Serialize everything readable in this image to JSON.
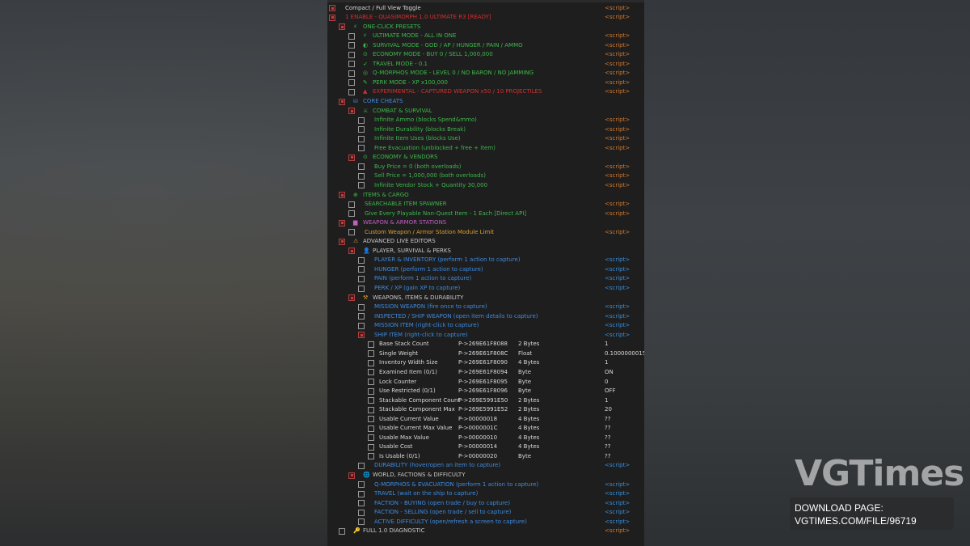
{
  "rows": [
    {
      "indent": 0,
      "checked": true,
      "icon": "",
      "iconColor": "",
      "label": "Compact / Full View Toggle",
      "color": "c-w",
      "script": "<script>",
      "scriptColor": "g"
    },
    {
      "indent": 0,
      "checked": true,
      "icon": "",
      "iconColor": "",
      "label": "1 ENABLE - QUASIMORPH 1.0 ULTIMATE R3 [READY]",
      "color": "c-r",
      "script": "<script>",
      "scriptColor": "g"
    },
    {
      "indent": 1,
      "checked": true,
      "icon": "⚡",
      "iconColor": "c-g",
      "label": "ONE-CLICK PRESETS",
      "color": "c-g",
      "script": "",
      "scriptColor": ""
    },
    {
      "indent": 2,
      "checked": false,
      "icon": "⚡",
      "iconColor": "c-g",
      "label": "ULTIMATE MODE - ALL IN ONE",
      "color": "c-g",
      "script": "<script>",
      "scriptColor": "g"
    },
    {
      "indent": 2,
      "checked": false,
      "icon": "◐",
      "iconColor": "c-g",
      "label": "SURVIVAL MODE - GOD / AP / HUNGER / PAIN / AMMO",
      "color": "c-g",
      "script": "<script>",
      "scriptColor": "g"
    },
    {
      "indent": 2,
      "checked": false,
      "icon": "⊙",
      "iconColor": "c-g",
      "label": "ECONOMY MODE - BUY 0 / SELL 1,000,000",
      "color": "c-g",
      "script": "<script>",
      "scriptColor": "g"
    },
    {
      "indent": 2,
      "checked": false,
      "icon": "➶",
      "iconColor": "c-g",
      "label": "TRAVEL MODE - 0.1",
      "color": "c-g",
      "script": "<script>",
      "scriptColor": "g"
    },
    {
      "indent": 2,
      "checked": false,
      "icon": "◎",
      "iconColor": "c-g",
      "label": "Q-MORPHOS MODE - LEVEL 0 / NO BARON / NO JAMMING",
      "color": "c-g",
      "script": "<script>",
      "scriptColor": "g"
    },
    {
      "indent": 2,
      "checked": false,
      "icon": "✎",
      "iconColor": "c-g",
      "label": "PERK MODE - XP x100,000",
      "color": "c-g",
      "script": "<script>",
      "scriptColor": "g"
    },
    {
      "indent": 2,
      "checked": false,
      "icon": "▲",
      "iconColor": "c-r",
      "label": "EXPERIMENTAL - CAPTURED WEAPON x50 / 10 PROJECTILES",
      "color": "c-r",
      "script": "<script>",
      "scriptColor": "g"
    },
    {
      "indent": 1,
      "checked": true,
      "icon": "⛁",
      "iconColor": "c-bl",
      "label": "CORE CHEATS",
      "color": "c-bl",
      "script": "",
      "scriptColor": ""
    },
    {
      "indent": 2,
      "checked": true,
      "icon": "⚔",
      "iconColor": "c-g",
      "label": "COMBAT & SURVIVAL",
      "color": "c-g",
      "script": "",
      "scriptColor": ""
    },
    {
      "indent": 3,
      "checked": false,
      "icon": "",
      "iconColor": "",
      "label": "Infinite Ammo (blocks Spend&mmo)",
      "color": "c-g",
      "script": "<script>",
      "scriptColor": "g"
    },
    {
      "indent": 3,
      "checked": false,
      "icon": "",
      "iconColor": "",
      "label": "Infinite Durability (blocks Break)",
      "color": "c-g",
      "script": "<script>",
      "scriptColor": "g"
    },
    {
      "indent": 3,
      "checked": false,
      "icon": "",
      "iconColor": "",
      "label": "Infinite Item Uses (blocks Use)",
      "color": "c-g",
      "script": "<script>",
      "scriptColor": "g"
    },
    {
      "indent": 3,
      "checked": false,
      "icon": "",
      "iconColor": "",
      "label": "Free Evacuation (unblocked + free + item)",
      "color": "c-g",
      "script": "<script>",
      "scriptColor": "g"
    },
    {
      "indent": 2,
      "checked": true,
      "icon": "⊙",
      "iconColor": "c-g",
      "label": "ECONOMY & VENDORS",
      "color": "c-g",
      "script": "",
      "scriptColor": ""
    },
    {
      "indent": 3,
      "checked": false,
      "icon": "",
      "iconColor": "",
      "label": "Buy Price = 0 (both overloads)",
      "color": "c-g",
      "script": "<script>",
      "scriptColor": "g"
    },
    {
      "indent": 3,
      "checked": false,
      "icon": "",
      "iconColor": "",
      "label": "Sell Price = 1,000,000 (both overloads)",
      "color": "c-g",
      "script": "<script>",
      "scriptColor": "g"
    },
    {
      "indent": 3,
      "checked": false,
      "icon": "",
      "iconColor": "",
      "label": "Infinite Vendor Stock + Quantity 30,000",
      "color": "c-g",
      "script": "<script>",
      "scriptColor": "g"
    },
    {
      "indent": 1,
      "checked": true,
      "icon": "⊕",
      "iconColor": "c-g",
      "label": "ITEMS & CARGO",
      "color": "c-g",
      "script": "",
      "scriptColor": ""
    },
    {
      "indent": 2,
      "checked": false,
      "icon": "",
      "iconColor": "",
      "label": "SEARCHABLE ITEM SPAWNER",
      "color": "c-g",
      "script": "<script>",
      "scriptColor": "g"
    },
    {
      "indent": 2,
      "checked": false,
      "icon": "",
      "iconColor": "",
      "label": "Give Every Playable Non-Quest Item - 1 Each [Direct API]",
      "color": "c-g",
      "script": "<script>",
      "scriptColor": "g"
    },
    {
      "indent": 1,
      "checked": true,
      "icon": "▆",
      "iconColor": "c-p",
      "label": "WEAPON & ARMOR STATIONS",
      "color": "c-p",
      "script": "",
      "scriptColor": ""
    },
    {
      "indent": 2,
      "checked": false,
      "icon": "",
      "iconColor": "",
      "label": "Custom Weapon / Armor Station Module Limit",
      "color": "c-y",
      "script": "<script>",
      "scriptColor": "g"
    },
    {
      "indent": 1,
      "checked": true,
      "icon": "⚠",
      "iconColor": "c-y",
      "label": "ADVANCED LIVE EDITORS",
      "color": "c-lg",
      "script": "",
      "scriptColor": ""
    },
    {
      "indent": 2,
      "checked": true,
      "icon": "👤",
      "iconColor": "c-y",
      "label": "PLAYER, SURVIVAL & PERKS",
      "color": "c-lg",
      "script": "",
      "scriptColor": ""
    },
    {
      "indent": 3,
      "checked": false,
      "icon": "",
      "iconColor": "",
      "label": "PLAYER & INVENTORY (perform 1 action to capture)",
      "color": "c-bl",
      "script": "<script>",
      "scriptColor": "b"
    },
    {
      "indent": 3,
      "checked": false,
      "icon": "",
      "iconColor": "",
      "label": "HUNGER (perform 1 action to capture)",
      "color": "c-bl",
      "script": "<script>",
      "scriptColor": "b"
    },
    {
      "indent": 3,
      "checked": false,
      "icon": "",
      "iconColor": "",
      "label": "PAIN (perform 1 action to capture)",
      "color": "c-bl",
      "script": "<script>",
      "scriptColor": "b"
    },
    {
      "indent": 3,
      "checked": false,
      "icon": "",
      "iconColor": "",
      "label": "PERK / XP (gain XP to capture)",
      "color": "c-bl",
      "script": "<script>",
      "scriptColor": "b"
    },
    {
      "indent": 2,
      "checked": true,
      "icon": "⚒",
      "iconColor": "c-y",
      "label": "WEAPONS, ITEMS & DURABILITY",
      "color": "c-lg",
      "script": "",
      "scriptColor": ""
    },
    {
      "indent": 3,
      "checked": false,
      "icon": "",
      "iconColor": "",
      "label": "MISSION WEAPON (fire once to capture)",
      "color": "c-bl",
      "script": "<script>",
      "scriptColor": "b"
    },
    {
      "indent": 3,
      "checked": false,
      "icon": "",
      "iconColor": "",
      "label": "INSPECTED / SHIP WEAPON (open item details to capture)",
      "color": "c-bl",
      "script": "<script>",
      "scriptColor": "b"
    },
    {
      "indent": 3,
      "checked": false,
      "icon": "",
      "iconColor": "",
      "label": "MISSION ITEM (right-click to capture)",
      "color": "c-bl",
      "script": "<script>",
      "scriptColor": "b"
    },
    {
      "indent": 3,
      "checked": true,
      "icon": "",
      "iconColor": "",
      "label": "SHIP ITEM (right-click to capture)",
      "color": "c-bl",
      "script": "<script>",
      "scriptColor": "b"
    }
  ],
  "memrows": [
    {
      "label": "Base Stack Count",
      "addr": "P->269E61F8088",
      "type": "2 Bytes",
      "value": "1"
    },
    {
      "label": "Single Weight",
      "addr": "P->269E61F808C",
      "type": "Float",
      "value": "0.1000000015"
    },
    {
      "label": "Inventory Width Size",
      "addr": "P->269E61F8090",
      "type": "4 Bytes",
      "value": "1"
    },
    {
      "label": "Examined Item (0/1)",
      "addr": "P->269E61F8094",
      "type": "Byte",
      "value": "ON"
    },
    {
      "label": "Lock Counter",
      "addr": "P->269E61F8095",
      "type": "Byte",
      "value": "0"
    },
    {
      "label": "Use Restricted (0/1)",
      "addr": "P->269E61F8096",
      "type": "Byte",
      "value": "OFF"
    },
    {
      "label": "Stackable Component Count",
      "addr": "P->269E5991E50",
      "type": "2 Bytes",
      "value": "1"
    },
    {
      "label": "Stackable Component Max",
      "addr": "P->269E5991E52",
      "type": "2 Bytes",
      "value": "20"
    },
    {
      "label": "Usable Current Value",
      "addr": "P->00000018",
      "type": "4 Bytes",
      "value": "??"
    },
    {
      "label": "Usable Current Max Value",
      "addr": "P->0000001C",
      "type": "4 Bytes",
      "value": "??"
    },
    {
      "label": "Usable Max Value",
      "addr": "P->00000010",
      "type": "4 Bytes",
      "value": "??"
    },
    {
      "label": "Usable Cost",
      "addr": "P->00000014",
      "type": "4 Bytes",
      "value": "??"
    },
    {
      "label": "Is Usable (0/1)",
      "addr": "P->00000020",
      "type": "Byte",
      "value": "??"
    }
  ],
  "tailrows": [
    {
      "indent": 3,
      "checked": false,
      "icon": "",
      "iconColor": "",
      "label": "DURABILITY (hover/open an item to capture)",
      "color": "c-bl",
      "script": "<script>",
      "scriptColor": "b"
    },
    {
      "indent": 2,
      "checked": true,
      "icon": "🌐",
      "iconColor": "c-y",
      "label": "WORLD, FACTIONS & DIFFICULTY",
      "color": "c-lg",
      "script": "",
      "scriptColor": ""
    },
    {
      "indent": 3,
      "checked": false,
      "icon": "",
      "iconColor": "",
      "label": "Q-MORPHOS & EVACUATION (perform 1 action to capture)",
      "color": "c-bl",
      "script": "<script>",
      "scriptColor": "b"
    },
    {
      "indent": 3,
      "checked": false,
      "icon": "",
      "iconColor": "",
      "label": "TRAVEL (wait on the ship to capture)",
      "color": "c-bl",
      "script": "<script>",
      "scriptColor": "b"
    },
    {
      "indent": 3,
      "checked": false,
      "icon": "",
      "iconColor": "",
      "label": "FACTION - BUYING (open trade / buy to capture)",
      "color": "c-bl",
      "script": "<script>",
      "scriptColor": "b"
    },
    {
      "indent": 3,
      "checked": false,
      "icon": "",
      "iconColor": "",
      "label": "FACTION - SELLING (open trade / sell to capture)",
      "color": "c-bl",
      "script": "<script>",
      "scriptColor": "b"
    },
    {
      "indent": 3,
      "checked": false,
      "icon": "",
      "iconColor": "",
      "label": "ACTIVE DIFFICULTY (open/refresh a screen to capture)",
      "color": "c-bl",
      "script": "<script>",
      "scriptColor": "b"
    },
    {
      "indent": 1,
      "checked": false,
      "icon": "🔑",
      "iconColor": "c-y",
      "label": "FULL 1.0 DIAGNOSTIC",
      "color": "c-lg",
      "script": "<script>",
      "scriptColor": "g"
    }
  ],
  "watermark": {
    "brand": "VGTimes",
    "line1": "DOWNLOAD PAGE:",
    "line2": "VGTIMES.COM/FILE/96719"
  }
}
